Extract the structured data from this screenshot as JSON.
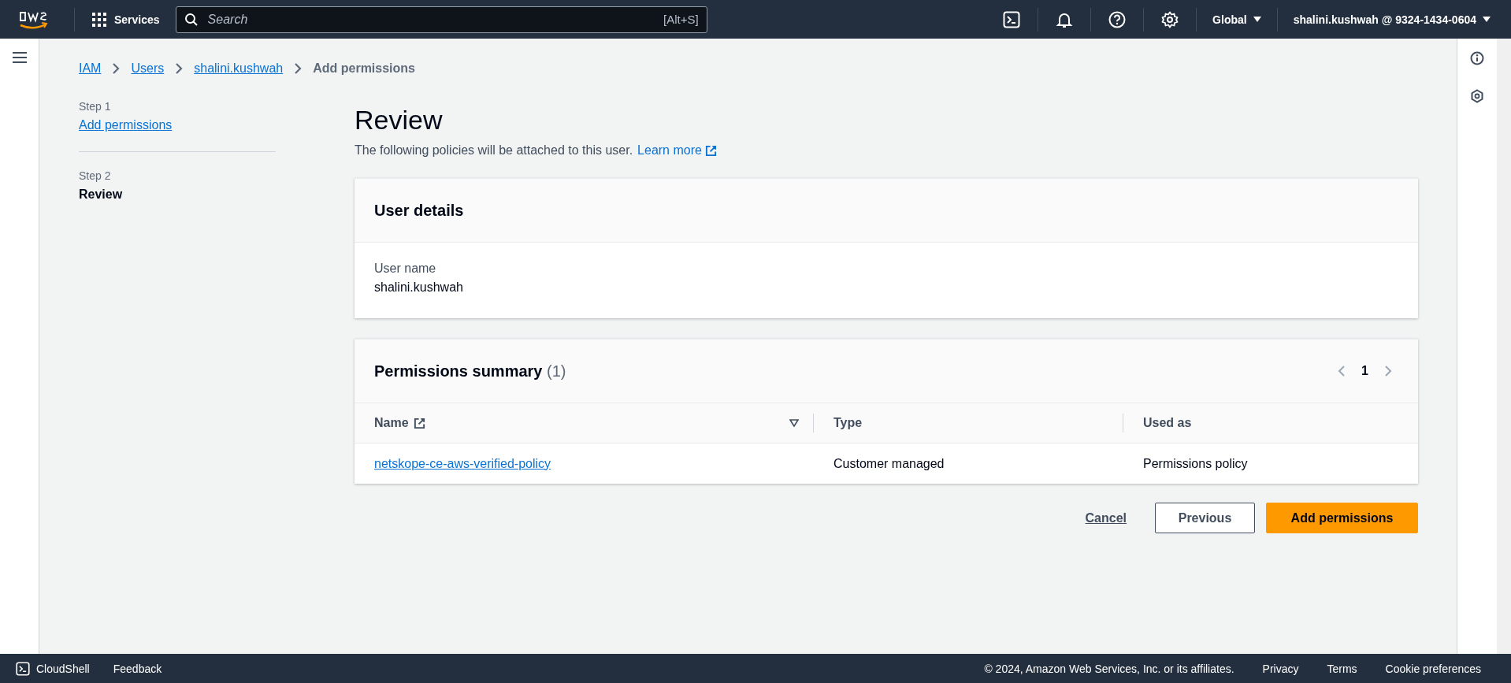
{
  "top_nav": {
    "services": "Services",
    "search": {
      "placeholder": "Search",
      "shortcut": "[Alt+S]"
    },
    "region": "Global",
    "account": "shalini.kushwah @ 9324-1434-0604"
  },
  "breadcrumbs": [
    {
      "label": "IAM",
      "link": true
    },
    {
      "label": "Users",
      "link": true
    },
    {
      "label": "shalini.kushwah",
      "link": true
    },
    {
      "label": "Add permissions",
      "link": false
    }
  ],
  "steps": [
    {
      "number": "Step 1",
      "label": "Add permissions",
      "selected": false
    },
    {
      "number": "Step 2",
      "label": "Review",
      "selected": true
    }
  ],
  "page": {
    "title": "Review",
    "description": "The following policies will be attached to this user.",
    "learn_more": "Learn more"
  },
  "user_details": {
    "title": "User details",
    "label": "User name",
    "value": "shalini.kushwah"
  },
  "permissions_summary": {
    "title": "Permissions summary",
    "count": "(1)",
    "pages": [
      {
        "label": "1",
        "selected": true
      }
    ],
    "columns": [
      {
        "label": "Name",
        "external": true,
        "sortable": true
      },
      {
        "label": "Type",
        "external": false,
        "sortable": false
      },
      {
        "label": "Used as",
        "external": false,
        "sortable": false
      }
    ],
    "rows": [
      {
        "name": "netskope-ce-aws-verified-policy",
        "type": "Customer managed",
        "used_as": "Permissions policy"
      }
    ]
  },
  "actions": [
    {
      "label": "Cancel",
      "kind": "link"
    },
    {
      "label": "Previous",
      "kind": "normal"
    },
    {
      "label": "Add permissions",
      "kind": "primary"
    }
  ],
  "footer": {
    "cloudshell": "CloudShell",
    "feedback": "Feedback",
    "copyright": "© 2024, Amazon Web Services, Inc. or its affiliates.",
    "links": [
      "Privacy",
      "Terms",
      "Cookie preferences"
    ]
  }
}
